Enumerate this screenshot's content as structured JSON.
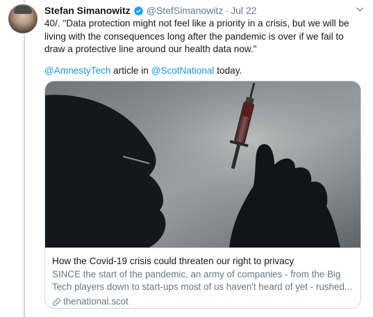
{
  "tweet": {
    "author_name": "Stefan Simanowitz",
    "handle": "@StefSimanowitz",
    "separator": "·",
    "time": "Jul 22",
    "text": "40/. \"Data protection might not feel like a priority in a crisis, but we will be living with the consequences long after the pandemic is over if we fail to draw a protective line around our health data now.\"",
    "mention_1": "@AmnestyTech",
    "text_mid": " article in ",
    "mention_2": "@ScotNational",
    "text_end": " today."
  },
  "card": {
    "title": "How the Covid-19 crisis could threaten our right to privacy",
    "description": "SINCE the start of the pandemic, an army of companies - from the Big Tech players down to start-ups most of us haven't heard of yet - rushed...",
    "domain": "thenational.scot"
  },
  "icons": {
    "verified": "verified-badge-icon",
    "more": "chevron-down-icon",
    "link": "link-icon"
  },
  "colors": {
    "link": "#1b95e0",
    "muted": "#657786",
    "text": "#14171a",
    "border": "#ccd6dd"
  }
}
